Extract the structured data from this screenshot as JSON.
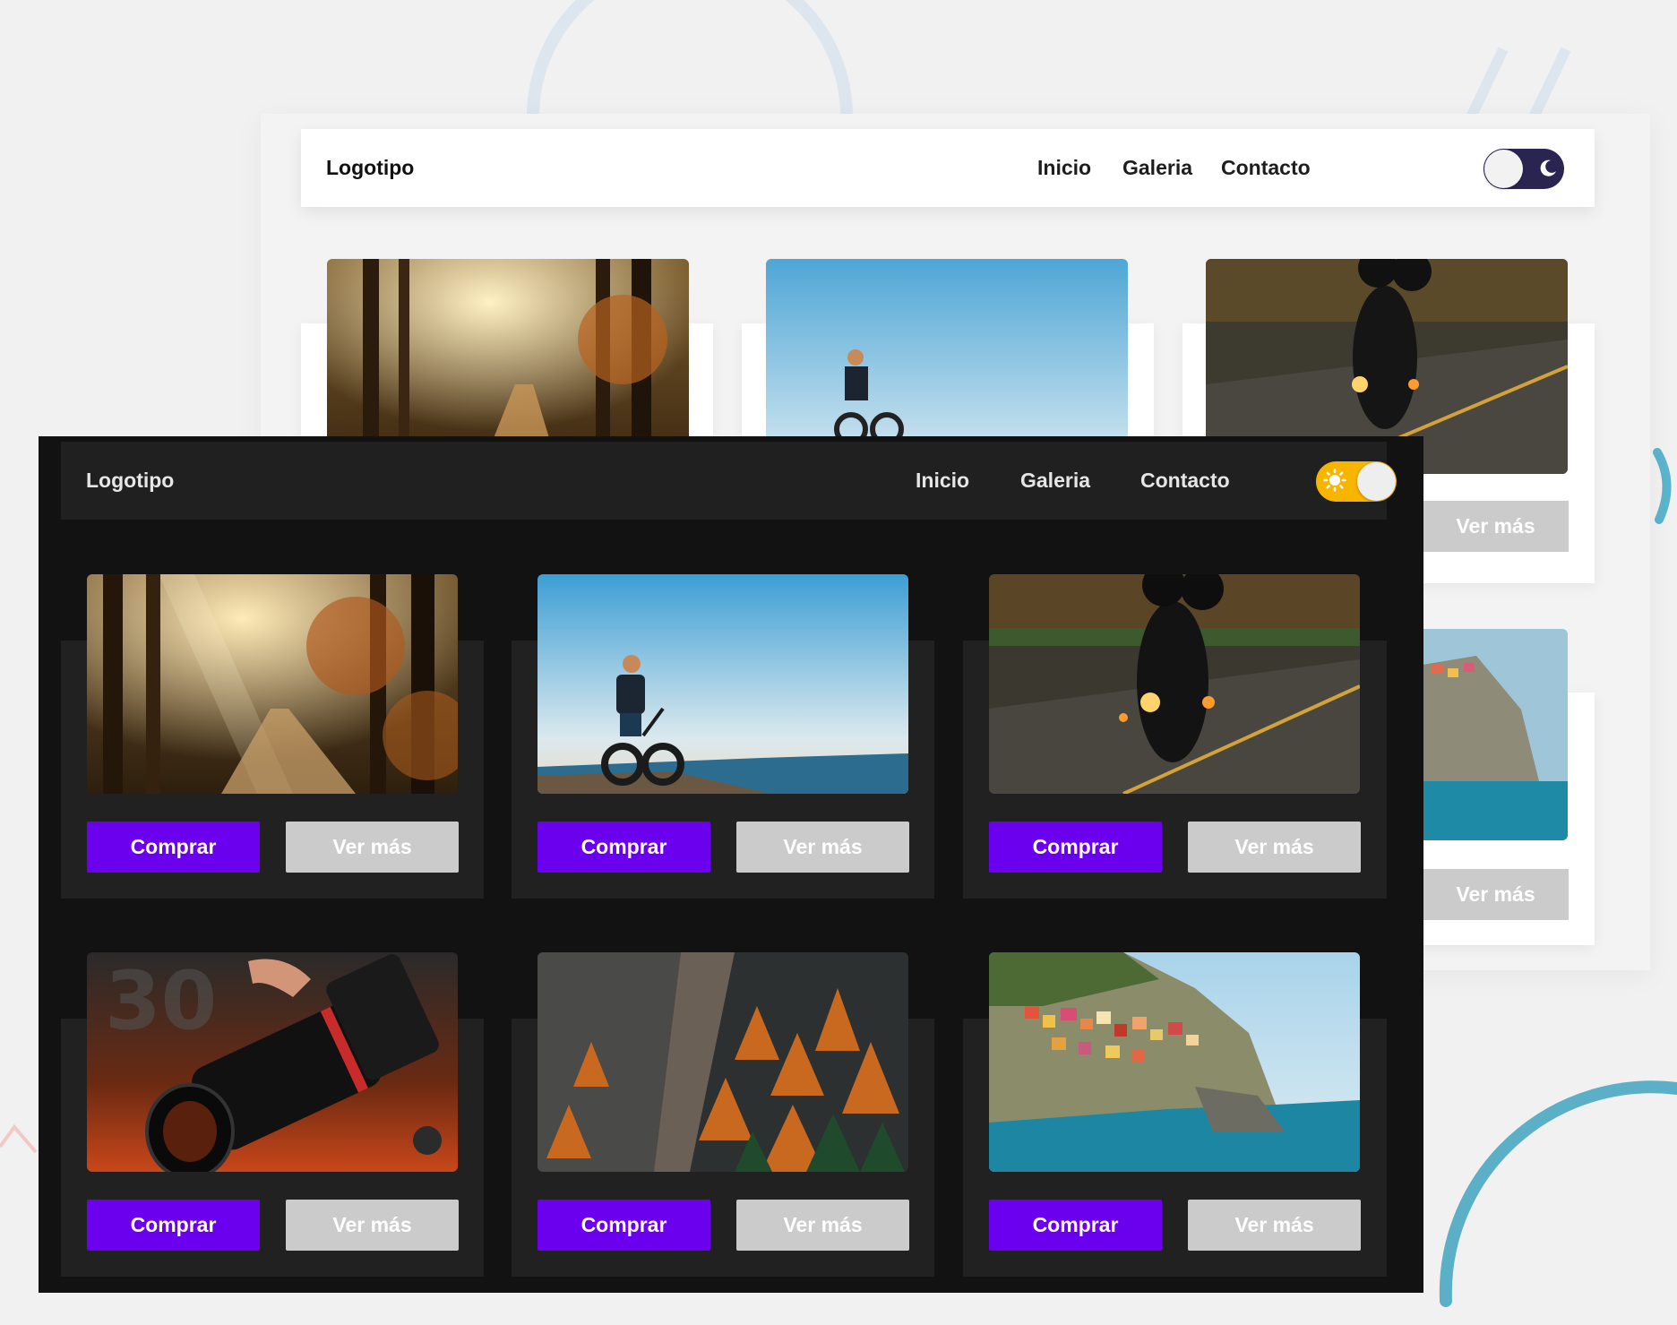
{
  "light_theme": {
    "nav": {
      "logo": "Logotipo",
      "links": [
        "Inicio",
        "Galeria",
        "Contacto"
      ],
      "theme_toggle": "dark-mode-toggle"
    },
    "cards": [
      {
        "image": "forest-sunrays"
      },
      {
        "image": "beach-bike-rider"
      },
      {
        "image": "motorcycle-night",
        "more_label": "Ver más"
      },
      {
        "image": "coastal-village",
        "more_label": "Ver más"
      }
    ]
  },
  "dark_theme": {
    "nav": {
      "logo": "Logotipo",
      "links": [
        "Inicio",
        "Galeria",
        "Contacto"
      ],
      "theme_toggle": "light-mode-toggle"
    },
    "cards": [
      {
        "image": "forest-sunrays",
        "buy_label": "Comprar",
        "more_label": "Ver más"
      },
      {
        "image": "beach-bike-rider",
        "buy_label": "Comprar",
        "more_label": "Ver más"
      },
      {
        "image": "motorcycle-night",
        "buy_label": "Comprar",
        "more_label": "Ver más"
      },
      {
        "image": "camera-lens",
        "buy_label": "Comprar",
        "more_label": "Ver más"
      },
      {
        "image": "autumn-cliff-forest",
        "buy_label": "Comprar",
        "more_label": "Ver más"
      },
      {
        "image": "coastal-village",
        "buy_label": "Comprar",
        "more_label": "Ver más"
      }
    ]
  },
  "colors": {
    "accent": "#6a00ee",
    "secondary_button": "#cbcbcb",
    "dark_bg": "#121212",
    "dark_card": "#212121",
    "toggle_dark": "#2a2550",
    "toggle_sun": "#f7b500"
  }
}
